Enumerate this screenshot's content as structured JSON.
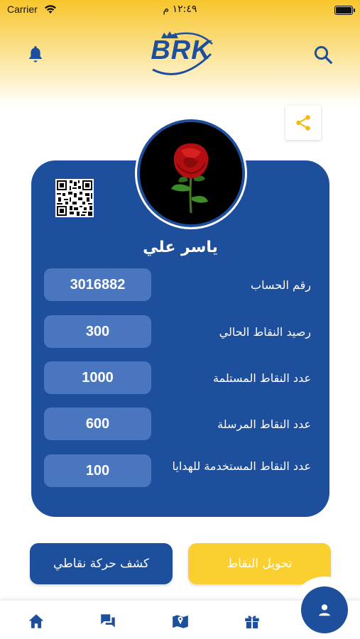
{
  "status_bar": {
    "carrier": "Carrier",
    "time": "١٢:٤٩ م"
  },
  "header": {
    "logo_text": "BRK",
    "bell_icon": "bell-icon",
    "search_icon": "search-icon"
  },
  "profile": {
    "name": "ياسر علي",
    "avatar_description": "red rose on black background",
    "share_icon": "share-icon"
  },
  "info_rows": [
    {
      "label": "رقم الحساب",
      "value": "3016882"
    },
    {
      "label": "رصيد النقاط الحالي",
      "value": "300"
    },
    {
      "label": "عدد النقاط المستلمة",
      "value": "1000"
    },
    {
      "label": "عدد النقاط المرسلة",
      "value": "600"
    },
    {
      "label": "عدد النقاط المستخدمة للهدايا",
      "value": "100"
    }
  ],
  "actions": {
    "statement_label": "كشف حركة نقاطي",
    "transfer_label": "تحويل النقاط"
  },
  "bottom_nav": {
    "items": [
      "home-icon",
      "chat-icon",
      "map-icon",
      "gift-icon"
    ],
    "active": "profile-icon"
  },
  "colors": {
    "brand_blue": "#1e4f9c",
    "brand_yellow": "#fbcf2f",
    "value_pill": "#4a76c0"
  }
}
